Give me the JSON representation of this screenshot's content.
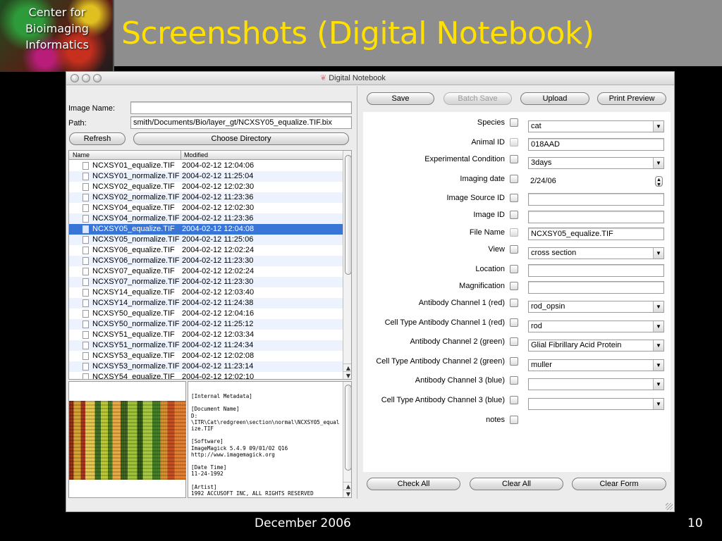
{
  "slide": {
    "logo_text": "Center for\nBioimaging\nInformatics",
    "title": "Screenshots (Digital Notebook)",
    "footer_date": "December 2006",
    "page_number": "10"
  },
  "window": {
    "title": "Digital Notebook"
  },
  "left": {
    "image_name_label": "Image Name:",
    "image_name_value": "",
    "path_label": "Path:",
    "path_value": "smith/Documents/Bio/layer_gt/NCXSY05_equalize.TIF.bix",
    "refresh_label": "Refresh",
    "choose_dir_label": "Choose Directory",
    "columns": [
      "Name",
      "Modified"
    ],
    "files": [
      {
        "name": "NCXSY01_equalize.TIF",
        "modified": "2004-02-12 12:04:06"
      },
      {
        "name": "NCXSY01_normalize.TIF",
        "modified": "2004-02-12 11:25:04"
      },
      {
        "name": "NCXSY02_equalize.TIF",
        "modified": "2004-02-12 12:02:30"
      },
      {
        "name": "NCXSY02_normalize.TIF",
        "modified": "2004-02-12 11:23:36"
      },
      {
        "name": "NCXSY04_equalize.TIF",
        "modified": "2004-02-12 12:02:30"
      },
      {
        "name": "NCXSY04_normalize.TIF",
        "modified": "2004-02-12 11:23:36"
      },
      {
        "name": "NCXSY05_equalize.TIF",
        "modified": "2004-02-12 12:04:08"
      },
      {
        "name": "NCXSY05_normalize.TIF",
        "modified": "2004-02-12 11:25:06"
      },
      {
        "name": "NCXSY06_equalize.TIF",
        "modified": "2004-02-12 12:02:24"
      },
      {
        "name": "NCXSY06_normalize.TIF",
        "modified": "2004-02-12 11:23:30"
      },
      {
        "name": "NCXSY07_equalize.TIF",
        "modified": "2004-02-12 12:02:24"
      },
      {
        "name": "NCXSY07_normalize.TIF",
        "modified": "2004-02-12 11:23:30"
      },
      {
        "name": "NCXSY14_equalize.TIF",
        "modified": "2004-02-12 12:03:40"
      },
      {
        "name": "NCXSY14_normalize.TIF",
        "modified": "2004-02-12 11:24:38"
      },
      {
        "name": "NCXSY50_equalize.TIF",
        "modified": "2004-02-12 12:04:16"
      },
      {
        "name": "NCXSY50_normalize.TIF",
        "modified": "2004-02-12 11:25:12"
      },
      {
        "name": "NCXSY51_equalize.TIF",
        "modified": "2004-02-12 12:03:34"
      },
      {
        "name": "NCXSY51_normalize.TIF",
        "modified": "2004-02-12 11:24:34"
      },
      {
        "name": "NCXSY53_equalize.TIF",
        "modified": "2004-02-12 12:02:08"
      },
      {
        "name": "NCXSY53_normalize.TIF",
        "modified": "2004-02-12 11:23:14"
      },
      {
        "name": "NCXSY54_equalize.TIF",
        "modified": "2004-02-12 12:02:10"
      }
    ],
    "selected_index": 6,
    "metadata": "[Internal Metadata]\n\n[Document Name]\nD:\n\\ITR\\Cat\\redgreen\\section\\normal\\NCXSY05_equalize.TIF\n\n[Software]\nImageMagick 5.4.9 09/01/02 Q16\nhttp://www.imagemagick.org\n\n[Date Time]\n11-24-1992\n\n[Artist]\n1992 ACCUSOFT INC, ALL RIGHTS RESERVED"
  },
  "toolbar": {
    "save_label": "Save",
    "batch_save_label": "Batch Save",
    "upload_label": "Upload",
    "print_preview_label": "Print Preview"
  },
  "form": {
    "species": {
      "label": "Species",
      "value": "cat"
    },
    "animal_id": {
      "label": "Animal ID",
      "value": "018AAD"
    },
    "experimental_condition": {
      "label": "Experimental Condition",
      "value": "3days"
    },
    "imaging_date": {
      "label": "Imaging date",
      "value": "2/24/06"
    },
    "image_source_id": {
      "label": "Image Source ID",
      "value": ""
    },
    "image_id": {
      "label": "Image ID",
      "value": ""
    },
    "file_name": {
      "label": "File Name",
      "value": "NCXSY05_equalize.TIF"
    },
    "view": {
      "label": "View",
      "value": "cross section"
    },
    "location": {
      "label": "Location",
      "value": ""
    },
    "magnification": {
      "label": "Magnification",
      "value": ""
    },
    "antibody_ch1": {
      "label": "Antibody Channel 1 (red)",
      "value": "rod_opsin"
    },
    "cell_type_ch1": {
      "label": "Cell Type Antibody Channel 1 (red)",
      "value": "rod"
    },
    "antibody_ch2": {
      "label": "Antibody Channel 2 (green)",
      "value": "Glial Fibrillary Acid Protein"
    },
    "cell_type_ch2": {
      "label": "Cell Type Antibody Channel 2 (green)",
      "value": "muller"
    },
    "antibody_ch3": {
      "label": "Antibody Channel 3 (blue)",
      "value": ""
    },
    "cell_type_ch3": {
      "label": "Cell Type Antibody Channel 3 (blue)",
      "value": ""
    },
    "notes": {
      "label": "notes"
    }
  },
  "bottom": {
    "check_all_label": "Check All",
    "clear_all_label": "Clear All",
    "clear_form_label": "Clear Form"
  },
  "colors": {
    "title_yellow": "#ffe000",
    "selection_blue": "#3875d7",
    "header_gray": "#8e8e8e"
  },
  "icons": [
    "traffic-light-icon",
    "app-icon",
    "file-icon",
    "checkbox-icon",
    "dropdown-arrow-icon",
    "stepper-icon",
    "resize-grip-icon"
  ]
}
